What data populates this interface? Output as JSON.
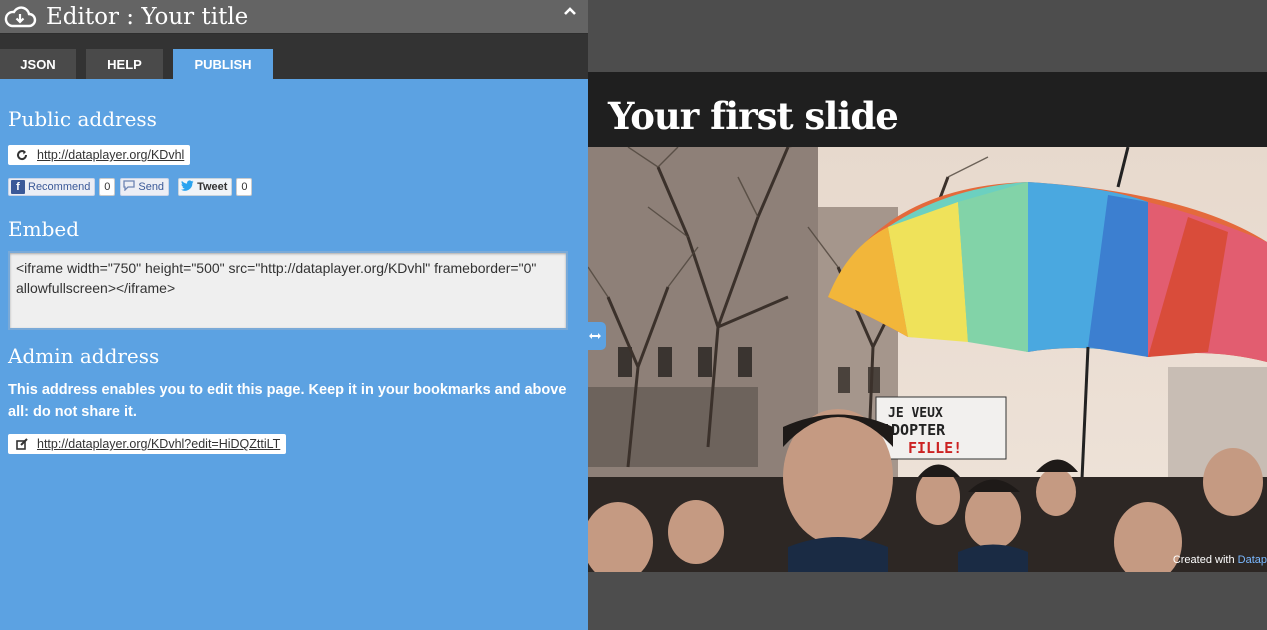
{
  "editor": {
    "title": "Editor : Your title",
    "tabs": [
      {
        "label": "JSON"
      },
      {
        "label": "HELP"
      },
      {
        "label": "PUBLISH"
      }
    ],
    "publish": {
      "public_address_heading": "Public address",
      "public_url": "http://dataplayer.org/KDvhl",
      "social": {
        "recommend_label": "Recommend",
        "recommend_count": "0",
        "send_label": "Send",
        "tweet_label": "Tweet",
        "tweet_count": "0"
      },
      "embed_heading": "Embed",
      "embed_code": "<iframe width=\"750\" height=\"500\" src=\"http://dataplayer.org/KDvhl\" frameborder=\"0\" allowfullscreen></iframe>",
      "admin_heading": "Admin address",
      "admin_text": "This address enables you to edit this page. Keep it in your bookmarks and above all:",
      "admin_text_strong": "do not share it.",
      "admin_url": "http://dataplayer.org/KDvhl?edit=HiDQZttiLT"
    }
  },
  "preview": {
    "slide_title": "Your first slide",
    "credit_prefix": "Created with",
    "credit_brand": "Datap",
    "image_sign_text_1": "JE VEUX",
    "image_sign_text_2": "ADOPTER",
    "image_sign_text_3": "FILLE!"
  },
  "colors": {
    "editor_bg": "#5ca2e2",
    "header_bg": "#646464",
    "tabbar_bg": "#333333",
    "preview_bg": "#4d4d4d",
    "slide_header_bg": "#1f1f1f"
  }
}
